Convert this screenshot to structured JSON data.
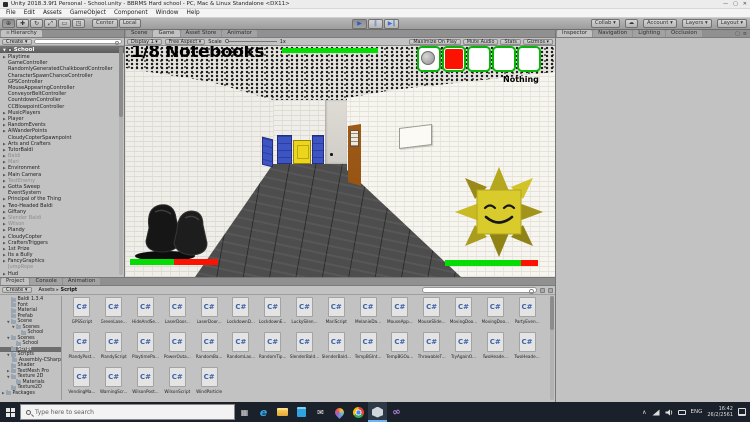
{
  "window": {
    "title": "Unity 2018.3.9f1 Personal - School.unity - BBRMS Hard school - PC, Mac & Linux Standalone <DX11>",
    "buttons": [
      {
        "name": "minimize-button",
        "glyph": "—"
      },
      {
        "name": "maximize-button",
        "glyph": "▢"
      },
      {
        "name": "close-button",
        "glyph": "✕"
      }
    ]
  },
  "menu_bar": {
    "items": [
      "File",
      "Edit",
      "Assets",
      "GameObject",
      "Component",
      "Window",
      "Help"
    ]
  },
  "toolbar": {
    "tools": [
      {
        "name": "hand-tool-icon",
        "glyph": "⊕",
        "pressed": true
      },
      {
        "name": "move-tool-icon",
        "glyph": "✚",
        "pressed": false
      },
      {
        "name": "rotate-tool-icon",
        "glyph": "↻",
        "pressed": false
      },
      {
        "name": "scale-tool-icon",
        "glyph": "⤢",
        "pressed": false
      },
      {
        "name": "rect-tool-icon",
        "glyph": "▭",
        "pressed": false
      },
      {
        "name": "transform-tool-icon",
        "glyph": "◳",
        "pressed": false
      }
    ],
    "pivot_label": "Center",
    "space_label": "Local",
    "play_controls": [
      {
        "name": "play-button",
        "glyph": "▶",
        "pressed": true
      },
      {
        "name": "pause-button",
        "glyph": "‖",
        "pressed": false
      },
      {
        "name": "step-button",
        "glyph": "▶‖",
        "pressed": false
      }
    ],
    "right_buttons": [
      {
        "name": "collab-dropdown",
        "label": "Collab ▾"
      },
      {
        "name": "cloud-button",
        "label": "☁"
      },
      {
        "name": "account-dropdown",
        "label": "Account ▾"
      },
      {
        "name": "layers-dropdown",
        "label": "Layers ▾"
      },
      {
        "name": "layout-dropdown",
        "label": "Layout ▾"
      }
    ]
  },
  "hierarchy": {
    "tab": "Hierarchy",
    "create_label": "Create ▾",
    "scene": "School",
    "items": [
      {
        "label": "Playtime",
        "arrow": true
      },
      {
        "label": "GameController"
      },
      {
        "label": "RandomlyGeneratedChalkboardController"
      },
      {
        "label": "CharacterSpawnChanceController"
      },
      {
        "label": "GPSController"
      },
      {
        "label": "MouseAppearingController"
      },
      {
        "label": "ConveyorBeltController"
      },
      {
        "label": "CountdownController"
      },
      {
        "label": "CCBlowpointController"
      },
      {
        "label": "MusicPlayers",
        "arrow": true
      },
      {
        "label": "Player",
        "arrow": true
      },
      {
        "label": "RandomEvents",
        "arrow": true
      },
      {
        "label": "AIWanderPoints",
        "arrow": true
      },
      {
        "label": "CloudyCopterSpawnpoint"
      },
      {
        "label": "Arts and Crafters",
        "arrow": true
      },
      {
        "label": "TutorBaldi",
        "arrow": true
      },
      {
        "label": "Baldi",
        "arrow": true,
        "dim": true
      },
      {
        "label": "Mari",
        "arrow": true,
        "dim": true
      },
      {
        "label": "Environment",
        "arrow": true
      },
      {
        "label": "Main Camera",
        "arrow": true
      },
      {
        "label": "TestEnemy",
        "arrow": true,
        "dim": true
      },
      {
        "label": "Gotta Sweep",
        "arrow": true
      },
      {
        "label": "EventSystem"
      },
      {
        "label": "Principal of the Thing",
        "arrow": true
      },
      {
        "label": "Two-Headed Baldi",
        "arrow": true
      },
      {
        "label": "Giftany",
        "arrow": true
      },
      {
        "label": "Slender Baldi",
        "arrow": true,
        "dim": true
      },
      {
        "label": "Wilson",
        "arrow": true,
        "dim": true
      },
      {
        "label": "Plandy",
        "arrow": true
      },
      {
        "label": "CloudyCopter",
        "arrow": true
      },
      {
        "label": "CraftersTriggers",
        "arrow": true
      },
      {
        "label": "1st Prize",
        "arrow": true
      },
      {
        "label": "Its a Bully",
        "arrow": true
      },
      {
        "label": "FancyGraphics",
        "arrow": true
      },
      {
        "label": "JumpRope",
        "dim": true
      },
      {
        "label": "Hud",
        "arrow": true
      }
    ]
  },
  "game_view": {
    "tabs": [
      {
        "label": "Scene",
        "active": false
      },
      {
        "label": "Game",
        "active": true
      },
      {
        "label": "Asset Store",
        "active": false
      },
      {
        "label": "Animator",
        "active": false
      }
    ],
    "display": "Display 1 ▾",
    "aspect": "Free Aspect ▾",
    "scale_label": "Scale",
    "scale_value": "1x",
    "buttons": [
      "Maximize On Play",
      "Mute Audio",
      "Stats",
      "Gizmos ▾"
    ],
    "hud": {
      "notebooks": "1/8 Notebooks",
      "item_label": "Nothing",
      "slots": [
        {
          "content": "coin"
        },
        {
          "content": "red"
        },
        {
          "content": "empty"
        },
        {
          "content": "empty"
        },
        {
          "content": "empty"
        }
      ]
    },
    "colors": {
      "health_green": "#04dc04",
      "bar_red": "#fb1200",
      "slot_border": "#0ab50a",
      "sun_yellow": "#d9cb2b"
    }
  },
  "inspector": {
    "tabs": [
      {
        "label": "Inspector",
        "active": true
      },
      {
        "label": "Navigation",
        "active": false
      },
      {
        "label": "Lighting",
        "active": false
      },
      {
        "label": "Occlusion",
        "active": false
      }
    ]
  },
  "project": {
    "tabs": [
      {
        "label": "Project",
        "active": true
      },
      {
        "label": "Console",
        "active": false
      },
      {
        "label": "Animation",
        "active": false
      }
    ],
    "create_label": "Create ▾",
    "breadcrumb_root": "Assets",
    "breadcrumb_sep": "▸",
    "breadcrumb_current": "Script",
    "folders": [
      {
        "label": "Baldi 1.3.4",
        "indent": 1
      },
      {
        "label": "Font",
        "indent": 1
      },
      {
        "label": "Material",
        "indent": 1
      },
      {
        "label": "Prefab",
        "indent": 1
      },
      {
        "label": "Scene",
        "indent": 1,
        "state": "open"
      },
      {
        "label": "Scenes",
        "indent": 2,
        "state": "open"
      },
      {
        "label": "School",
        "indent": 3
      },
      {
        "label": "Scenes",
        "indent": 1,
        "state": "open"
      },
      {
        "label": "School",
        "indent": 2
      },
      {
        "label": "Script",
        "indent": 1,
        "selected": true
      },
      {
        "label": "Scripts",
        "indent": 1,
        "state": "open"
      },
      {
        "label": "Assembly-CSharp",
        "indent": 2
      },
      {
        "label": "Shader",
        "indent": 1
      },
      {
        "label": "TextMesh Pro",
        "indent": 1,
        "state": "closed"
      },
      {
        "label": "Texture 2D",
        "indent": 1,
        "state": "open"
      },
      {
        "label": "Materials",
        "indent": 2
      },
      {
        "label": "Texture2D",
        "indent": 1
      },
      {
        "label": "Packages",
        "indent": 0,
        "state": "closed"
      }
    ],
    "scripts": {
      "rows": [
        [
          "GPSScript",
          "GreenLase...",
          "HideAndSe...",
          "LaserDoor...",
          "LaserDoor...",
          "LockdownD...",
          "LockdownE...",
          "LuckySilen...",
          "MariScript",
          "MelanieDa...",
          "MouseApp...",
          "MouseSlide...",
          "MovingDoo...",
          "MovingDoo...",
          "PartyEven..."
        ],
        [
          "PlandyPost...",
          "PlandyScript",
          "PlaytimePa...",
          "PowerOuta...",
          "RandomBa...",
          "RandomLas...",
          "RandomTip...",
          "SlenderBald...",
          "SlenderBald...",
          "TempBGInt...",
          "TempBGOu...",
          "ThrowableT...",
          "TryAgainO...",
          "TwoHeade...",
          "TwoHeade..."
        ],
        [
          "VendingMa...",
          "WarningScr...",
          "WilsonPost...",
          "WilsonScript",
          "WindParticle"
        ]
      ]
    }
  },
  "taskbar": {
    "search_placeholder": "Type here to search",
    "icons": [
      {
        "name": "task-view-icon",
        "glyph": "▦",
        "active": false
      },
      {
        "name": "edge-icon",
        "glyph": "e",
        "active": false
      },
      {
        "name": "file-explorer-icon",
        "glyph": "",
        "active": false
      },
      {
        "name": "store-icon",
        "glyph": "",
        "active": false
      },
      {
        "name": "mail-icon",
        "glyph": "✉",
        "active": false
      },
      {
        "name": "maps-icon",
        "glyph": "",
        "active": false
      },
      {
        "name": "chrome-icon",
        "glyph": "",
        "active": false
      },
      {
        "name": "unity-icon",
        "glyph": "",
        "active": true
      },
      {
        "name": "visual-studio-icon",
        "glyph": "∞",
        "active": false
      }
    ],
    "tray": {
      "chevron": "∧",
      "lang": "ENG",
      "time": "16:42",
      "date": "26/2/2561"
    }
  }
}
